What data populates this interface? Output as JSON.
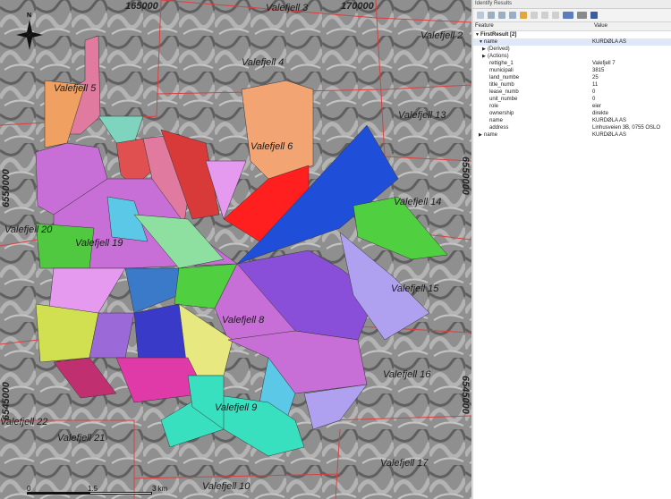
{
  "map": {
    "grid_labels": [
      "Valefjell 3",
      "Valefjell 2",
      "Valefjell 4",
      "Valefjell 5",
      "Valefjell 13",
      "Valefjell 6",
      "Valefjell 14",
      "Valefjell 20",
      "Valefjell 19",
      "Valefjell 15",
      "Valefjell 8",
      "Valefjell 16",
      "Valefjell 22",
      "Valefjell 9",
      "Valefjell 21",
      "Valefjell 17",
      "Valefjell 10"
    ],
    "x_coords": [
      "165000",
      "170000"
    ],
    "y_coords": [
      "6550000",
      "6550000",
      "6545000",
      "6545000"
    ],
    "north": "N",
    "scale": {
      "zero": "0",
      "mid": "1.5",
      "end": "3 km"
    }
  },
  "panel": {
    "title": "Identify Results",
    "col_feature": "Feature",
    "col_value": "Value",
    "rows": [
      {
        "k": "FirstResult  [2]",
        "v": ""
      },
      {
        "k": "name",
        "v": "KURDØLA AS"
      },
      {
        "k": "(Derived)",
        "v": ""
      },
      {
        "k": "(Actions)",
        "v": ""
      },
      {
        "k": "rettighe_1",
        "v": "Valefjell 7"
      },
      {
        "k": "municipali",
        "v": "3815"
      },
      {
        "k": "land_numbe",
        "v": "25"
      },
      {
        "k": "title_numb",
        "v": "11"
      },
      {
        "k": "lease_numb",
        "v": "0"
      },
      {
        "k": "unit_numbe",
        "v": "0"
      },
      {
        "k": "role",
        "v": "eier"
      },
      {
        "k": "ownership",
        "v": "direkte"
      },
      {
        "k": "name",
        "v": "KURDØLA AS"
      },
      {
        "k": "address",
        "v": "Linhusveien 3B, 0755 OSLO"
      },
      {
        "k": "name",
        "v": "KURDØLA AS"
      }
    ]
  },
  "colors": {
    "grid_line": "#d94040",
    "highlight": "#ff1f1f",
    "panel_bg": "#ffffff"
  }
}
